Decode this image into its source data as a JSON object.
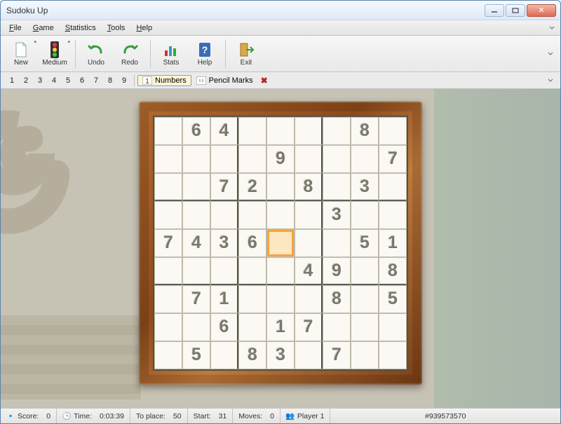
{
  "window": {
    "title": "Sudoku Up"
  },
  "menus": [
    "File",
    "Game",
    "Statistics",
    "Tools",
    "Help"
  ],
  "toolbar": {
    "new": "New",
    "medium": "Medium",
    "undo": "Undo",
    "redo": "Redo",
    "stats": "Stats",
    "help": "Help",
    "exit": "Exit"
  },
  "numbar": {
    "numbers": [
      "1",
      "2",
      "3",
      "4",
      "5",
      "6",
      "7",
      "8",
      "9"
    ],
    "mode_numbers": "Numbers",
    "mode_pencil": "Pencil Marks"
  },
  "board": {
    "grid": [
      [
        "",
        "6",
        "4",
        "",
        "",
        "",
        "",
        "8",
        ""
      ],
      [
        "",
        "",
        "",
        "",
        "9",
        "",
        "",
        "",
        "7"
      ],
      [
        "",
        "",
        "7",
        "2",
        "",
        "8",
        "",
        "3",
        ""
      ],
      [
        "",
        "",
        "",
        "",
        "",
        "",
        "3",
        "",
        ""
      ],
      [
        "7",
        "4",
        "3",
        "6",
        "",
        "",
        "",
        "5",
        "1"
      ],
      [
        "",
        "",
        "",
        "",
        "",
        "4",
        "9",
        "",
        "8"
      ],
      [
        "",
        "7",
        "1",
        "",
        "",
        "",
        "8",
        "",
        "5"
      ],
      [
        "",
        "",
        "6",
        "",
        "1",
        "7",
        "",
        "",
        ""
      ],
      [
        "",
        "5",
        "",
        "8",
        "3",
        "",
        "7",
        "",
        ""
      ]
    ],
    "cursor": {
      "row": 4,
      "col": 4
    }
  },
  "status": {
    "score_label": "Score:",
    "score_val": "0",
    "time_label": "Time:",
    "time_val": "0:03:39",
    "toplace_label": "To place:",
    "toplace_val": "50",
    "start_label": "Start:",
    "start_val": "31",
    "moves_label": "Moves:",
    "moves_val": "0",
    "player_label": "Player 1",
    "gameid": "#939573570"
  }
}
